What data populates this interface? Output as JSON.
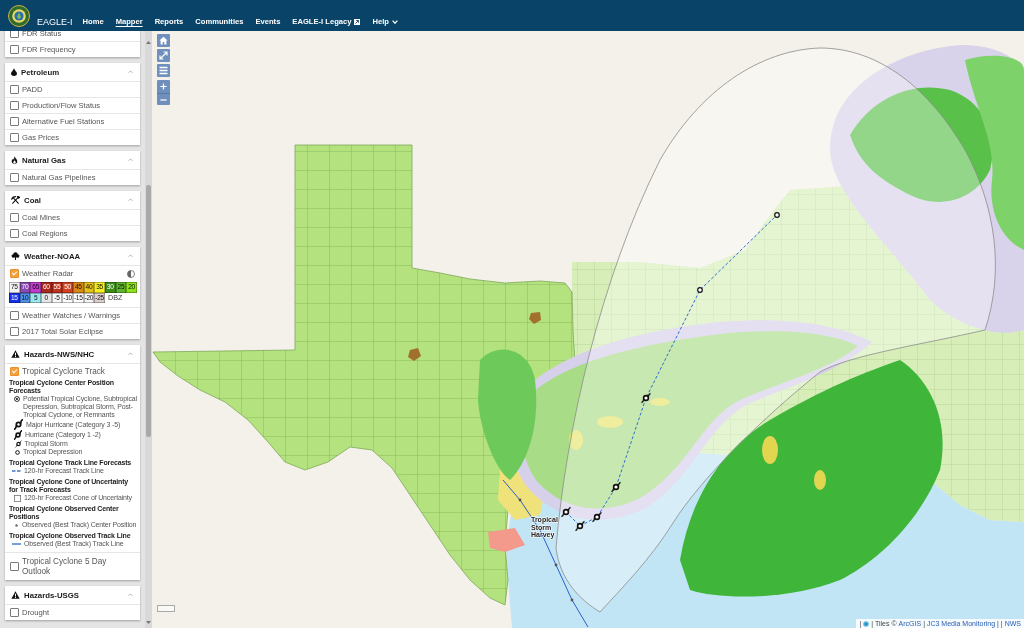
{
  "nav": {
    "brand": "EAGLE-I",
    "items": [
      {
        "label": "Home",
        "selected": false,
        "kind": "plain"
      },
      {
        "label": "Mapper",
        "selected": true,
        "kind": "plain"
      },
      {
        "label": "Reports",
        "selected": false,
        "kind": "plain"
      },
      {
        "label": "Communities",
        "selected": false,
        "kind": "plain"
      },
      {
        "label": "Events",
        "selected": false,
        "kind": "plain"
      },
      {
        "label": "EAGLE-I Legacy",
        "selected": false,
        "kind": "external"
      },
      {
        "label": "Help",
        "selected": false,
        "kind": "dropdown"
      }
    ]
  },
  "sidebar": {
    "sections": [
      {
        "rows": [
          {
            "label": "FDR Status",
            "checked": false,
            "kind": "layer"
          },
          {
            "label": "FDR Frequency",
            "checked": false,
            "kind": "layer"
          }
        ]
      },
      {
        "title": "Petroleum",
        "kind": "petroleum",
        "expanded": true,
        "rows": [
          {
            "label": "PADD",
            "checked": false,
            "kind": "layer"
          },
          {
            "label": "Production/Flow Status",
            "checked": false,
            "kind": "layer"
          },
          {
            "label": "Alternative Fuel Stations",
            "checked": false,
            "kind": "layer"
          },
          {
            "label": "Gas Prices",
            "checked": false,
            "kind": "layer"
          }
        ]
      },
      {
        "title": "Natural Gas",
        "kind": "gas",
        "expanded": true,
        "rows": [
          {
            "label": "Natural Gas Pipelines",
            "checked": false,
            "kind": "layer"
          }
        ]
      },
      {
        "title": "Coal",
        "kind": "coal",
        "expanded": true,
        "rows": [
          {
            "label": "Coal Mines",
            "checked": false,
            "kind": "layer"
          },
          {
            "label": "Coal Regions",
            "checked": false,
            "kind": "layer"
          }
        ]
      },
      {
        "title": "Weather-NOAA",
        "kind": "weather",
        "expanded": true,
        "rows": [
          {
            "label": "Weather Radar",
            "checked": true,
            "kind": "radar",
            "legend": {
              "rows": [
                [
                  {
                    "label": "75",
                    "color": "#f2f2f2"
                  },
                  {
                    "label": "70",
                    "color": "#8a4bb0"
                  },
                  {
                    "label": "65",
                    "color": "#c43ccf"
                  },
                  {
                    "label": "60",
                    "color": "#a8281c"
                  },
                  {
                    "label": "55",
                    "color": "#c0321e"
                  },
                  {
                    "label": "50",
                    "color": "#d2401e"
                  },
                  {
                    "label": "45",
                    "color": "#d98a12"
                  },
                  {
                    "label": "40",
                    "color": "#e6c11c"
                  },
                  {
                    "label": "35",
                    "color": "#f5ee22"
                  },
                  {
                    "label": "30",
                    "color": "#3d8b1d"
                  },
                  {
                    "label": "25",
                    "color": "#5cb52a"
                  },
                  {
                    "label": "20",
                    "color": "#8be21a"
                  }
                ],
                [
                  {
                    "label": "15",
                    "color": "#1530e8"
                  },
                  {
                    "label": "10",
                    "color": "#4f8fe6"
                  },
                  {
                    "label": "5",
                    "color": "#98e8ee"
                  },
                  {
                    "label": "0",
                    "color": "#e6e6e6"
                  },
                  {
                    "label": "-5",
                    "color": "#f8f8f8"
                  },
                  {
                    "label": "-10",
                    "color": "#ffffff"
                  },
                  {
                    "label": "-15",
                    "color": "#ffffff"
                  },
                  {
                    "label": "-20",
                    "color": "#f6f6f6"
                  },
                  {
                    "label": "-25",
                    "color": "#ddd0cc"
                  }
                ]
              ],
              "unit": "DBZ"
            }
          },
          {
            "label": "Weather Watches / Warnings",
            "checked": false,
            "kind": "layer"
          },
          {
            "label": "2017 Total Solar Eclipse",
            "checked": false,
            "kind": "layer"
          }
        ]
      },
      {
        "title": "Hazards-NWS/NHC",
        "kind": "hazard",
        "expanded": true,
        "rows": [
          {
            "label": "Tropical Cyclone Track",
            "checked": true,
            "kind": "cyclone",
            "legend": [
              {
                "title": "Tropical Cyclone Center Position Forecasts",
                "items": [
                  {
                    "kind": "ptc",
                    "label": "Potential Tropical Cyclone, Subtropical Depression, Subtropical Storm, Post-Tropical Cyclone, or Remnants"
                  },
                  {
                    "kind": "major",
                    "label": "Major Hurricane (Category 3 -5)"
                  },
                  {
                    "kind": "hurricane",
                    "label": "Hurricane (Category 1 -2)"
                  },
                  {
                    "kind": "storm",
                    "label": "Tropical Storm"
                  },
                  {
                    "kind": "depression",
                    "label": "Tropical Depression"
                  }
                ]
              },
              {
                "title": "Tropical Cyclone Track Line Forecasts",
                "items": [
                  {
                    "kind": "dashed",
                    "label": "120-hr Forecast Track Line"
                  }
                ]
              },
              {
                "title": "Tropical Cyclone Cone of Uncertainty for Track Forecasts",
                "items": [
                  {
                    "kind": "cone",
                    "label": "120-hr Forecast Cone of Uncertainty"
                  }
                ]
              },
              {
                "title": "Tropical Cyclone Observed Center Positions",
                "items": [
                  {
                    "kind": "dot",
                    "label": "Observed (Best Track) Center Position"
                  }
                ]
              },
              {
                "title": "Tropical Cyclone Observed Track Line",
                "items": [
                  {
                    "kind": "solid",
                    "label": "Observed (Best Track) Track Line"
                  }
                ]
              }
            ]
          },
          {
            "label": "Tropical Cyclone 5 Day Outlook",
            "checked": false,
            "kind": "large"
          }
        ]
      },
      {
        "title": "Hazards-USGS",
        "kind": "hazard",
        "expanded": true,
        "rows": [
          {
            "label": "Drought",
            "checked": false,
            "kind": "layer"
          }
        ]
      }
    ]
  },
  "map": {
    "controls": [
      {
        "kind": "home"
      },
      {
        "kind": "extent"
      },
      {
        "kind": "layers"
      },
      {
        "kind": "zoom-in"
      },
      {
        "kind": "zoom-out"
      }
    ],
    "storm_label": "Tropical Storm Harvey",
    "attribution": [
      {
        "kind": "text",
        "text": "|"
      },
      {
        "kind": "icon"
      },
      {
        "kind": "text",
        "text": "| Tiles ©"
      },
      {
        "kind": "link",
        "text": "ArcGIS"
      },
      {
        "kind": "text",
        "text": "|"
      },
      {
        "kind": "link",
        "text": "JC3 Media Monitoring"
      },
      {
        "kind": "text",
        "text": "| |"
      },
      {
        "kind": "link",
        "text": "NWS"
      }
    ]
  }
}
